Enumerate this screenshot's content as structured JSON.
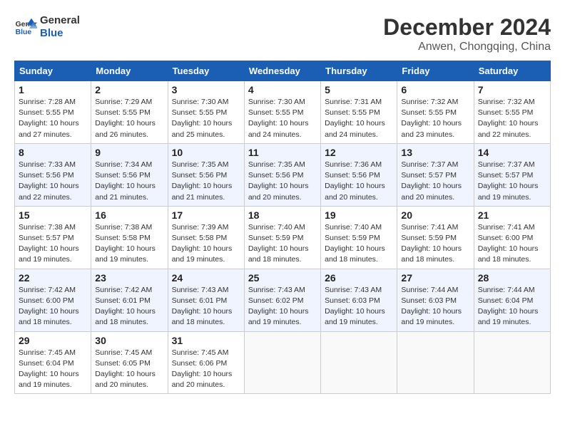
{
  "logo": {
    "line1": "General",
    "line2": "Blue"
  },
  "title": "December 2024",
  "location": "Anwen, Chongqing, China",
  "weekdays": [
    "Sunday",
    "Monday",
    "Tuesday",
    "Wednesday",
    "Thursday",
    "Friday",
    "Saturday"
  ],
  "weeks": [
    [
      {
        "day": "1",
        "info": "Sunrise: 7:28 AM\nSunset: 5:55 PM\nDaylight: 10 hours\nand 27 minutes."
      },
      {
        "day": "2",
        "info": "Sunrise: 7:29 AM\nSunset: 5:55 PM\nDaylight: 10 hours\nand 26 minutes."
      },
      {
        "day": "3",
        "info": "Sunrise: 7:30 AM\nSunset: 5:55 PM\nDaylight: 10 hours\nand 25 minutes."
      },
      {
        "day": "4",
        "info": "Sunrise: 7:30 AM\nSunset: 5:55 PM\nDaylight: 10 hours\nand 24 minutes."
      },
      {
        "day": "5",
        "info": "Sunrise: 7:31 AM\nSunset: 5:55 PM\nDaylight: 10 hours\nand 24 minutes."
      },
      {
        "day": "6",
        "info": "Sunrise: 7:32 AM\nSunset: 5:55 PM\nDaylight: 10 hours\nand 23 minutes."
      },
      {
        "day": "7",
        "info": "Sunrise: 7:32 AM\nSunset: 5:55 PM\nDaylight: 10 hours\nand 22 minutes."
      }
    ],
    [
      {
        "day": "8",
        "info": "Sunrise: 7:33 AM\nSunset: 5:56 PM\nDaylight: 10 hours\nand 22 minutes."
      },
      {
        "day": "9",
        "info": "Sunrise: 7:34 AM\nSunset: 5:56 PM\nDaylight: 10 hours\nand 21 minutes."
      },
      {
        "day": "10",
        "info": "Sunrise: 7:35 AM\nSunset: 5:56 PM\nDaylight: 10 hours\nand 21 minutes."
      },
      {
        "day": "11",
        "info": "Sunrise: 7:35 AM\nSunset: 5:56 PM\nDaylight: 10 hours\nand 20 minutes."
      },
      {
        "day": "12",
        "info": "Sunrise: 7:36 AM\nSunset: 5:56 PM\nDaylight: 10 hours\nand 20 minutes."
      },
      {
        "day": "13",
        "info": "Sunrise: 7:37 AM\nSunset: 5:57 PM\nDaylight: 10 hours\nand 20 minutes."
      },
      {
        "day": "14",
        "info": "Sunrise: 7:37 AM\nSunset: 5:57 PM\nDaylight: 10 hours\nand 19 minutes."
      }
    ],
    [
      {
        "day": "15",
        "info": "Sunrise: 7:38 AM\nSunset: 5:57 PM\nDaylight: 10 hours\nand 19 minutes."
      },
      {
        "day": "16",
        "info": "Sunrise: 7:38 AM\nSunset: 5:58 PM\nDaylight: 10 hours\nand 19 minutes."
      },
      {
        "day": "17",
        "info": "Sunrise: 7:39 AM\nSunset: 5:58 PM\nDaylight: 10 hours\nand 19 minutes."
      },
      {
        "day": "18",
        "info": "Sunrise: 7:40 AM\nSunset: 5:59 PM\nDaylight: 10 hours\nand 18 minutes."
      },
      {
        "day": "19",
        "info": "Sunrise: 7:40 AM\nSunset: 5:59 PM\nDaylight: 10 hours\nand 18 minutes."
      },
      {
        "day": "20",
        "info": "Sunrise: 7:41 AM\nSunset: 5:59 PM\nDaylight: 10 hours\nand 18 minutes."
      },
      {
        "day": "21",
        "info": "Sunrise: 7:41 AM\nSunset: 6:00 PM\nDaylight: 10 hours\nand 18 minutes."
      }
    ],
    [
      {
        "day": "22",
        "info": "Sunrise: 7:42 AM\nSunset: 6:00 PM\nDaylight: 10 hours\nand 18 minutes."
      },
      {
        "day": "23",
        "info": "Sunrise: 7:42 AM\nSunset: 6:01 PM\nDaylight: 10 hours\nand 18 minutes."
      },
      {
        "day": "24",
        "info": "Sunrise: 7:43 AM\nSunset: 6:01 PM\nDaylight: 10 hours\nand 18 minutes."
      },
      {
        "day": "25",
        "info": "Sunrise: 7:43 AM\nSunset: 6:02 PM\nDaylight: 10 hours\nand 19 minutes."
      },
      {
        "day": "26",
        "info": "Sunrise: 7:43 AM\nSunset: 6:03 PM\nDaylight: 10 hours\nand 19 minutes."
      },
      {
        "day": "27",
        "info": "Sunrise: 7:44 AM\nSunset: 6:03 PM\nDaylight: 10 hours\nand 19 minutes."
      },
      {
        "day": "28",
        "info": "Sunrise: 7:44 AM\nSunset: 6:04 PM\nDaylight: 10 hours\nand 19 minutes."
      }
    ],
    [
      {
        "day": "29",
        "info": "Sunrise: 7:45 AM\nSunset: 6:04 PM\nDaylight: 10 hours\nand 19 minutes."
      },
      {
        "day": "30",
        "info": "Sunrise: 7:45 AM\nSunset: 6:05 PM\nDaylight: 10 hours\nand 20 minutes."
      },
      {
        "day": "31",
        "info": "Sunrise: 7:45 AM\nSunset: 6:06 PM\nDaylight: 10 hours\nand 20 minutes."
      },
      null,
      null,
      null,
      null
    ]
  ]
}
